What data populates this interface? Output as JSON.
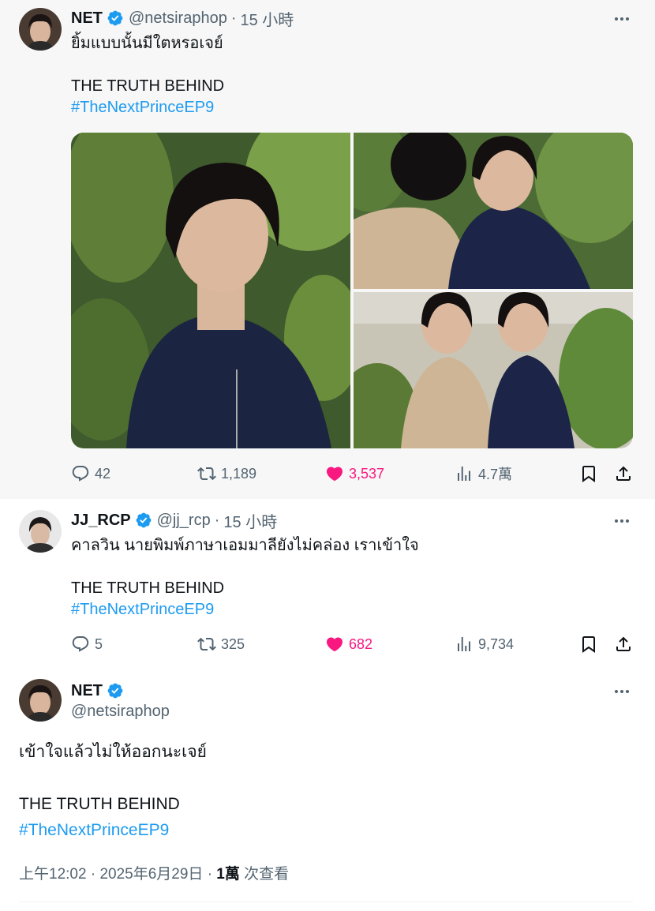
{
  "tweets": [
    {
      "name": "NET",
      "handle": "@netsiraphop",
      "separator": "·",
      "time": "15 小時",
      "text": "ยิ้มแบบนั้นมีใตหรอเจย์",
      "line2": "THE TRUTH BEHIND",
      "hashtag": "#TheNextPrinceEP9",
      "replies": "42",
      "retweets": "1,189",
      "likes": "3,537",
      "views": "4.7萬"
    },
    {
      "name": "JJ_RCP",
      "handle": "@jj_rcp",
      "separator": "·",
      "time": "15 小時",
      "text": "คาลวิน นายพิมพ์ภาษาเอมมาลียังไม่คล่อง เราเข้าใจ",
      "line2": "THE TRUTH BEHIND",
      "hashtag": "#TheNextPrinceEP9",
      "replies": "5",
      "retweets": "325",
      "likes": "682",
      "views": "9,734"
    }
  ],
  "main_tweet": {
    "name": "NET",
    "handle": "@netsiraphop",
    "text": "เข้าใจแล้วไม่ให้ออกนะเจย์",
    "line2": "THE TRUTH BEHIND",
    "hashtag": "#TheNextPrinceEP9",
    "time": "上午12:02",
    "separator": "·",
    "date": "2025年6月29日",
    "views_count": "1萬",
    "views_label": "次查看"
  },
  "colors": {
    "accent": "#1d9bf0",
    "like": "#f91880",
    "muted": "#536471",
    "text": "#0f1419"
  },
  "icons": [
    "verified-badge-icon",
    "more-icon",
    "reply-icon",
    "retweet-icon",
    "heart-filled-icon",
    "views-icon",
    "bookmark-icon",
    "share-icon"
  ]
}
